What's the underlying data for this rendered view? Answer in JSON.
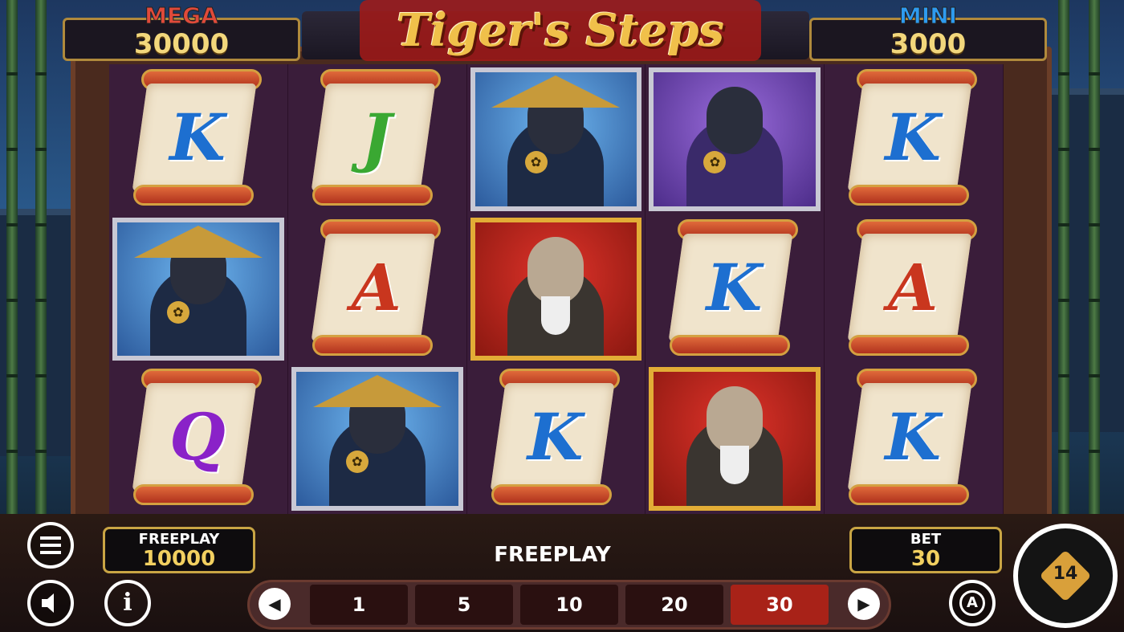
{
  "game_title": "Tiger's Steps",
  "jackpots": {
    "mega": {
      "label": "MEGA",
      "value": "30000",
      "color": "#e04a3a"
    },
    "mini": {
      "label": "MINI",
      "value": "3000",
      "color": "#2e9bef"
    }
  },
  "reels": [
    [
      {
        "type": "scroll",
        "letter": "K",
        "color": "#1d6fd0"
      },
      {
        "type": "ninja-blue"
      },
      {
        "type": "scroll",
        "letter": "Q",
        "color": "#8a22c8"
      }
    ],
    [
      {
        "type": "scroll",
        "letter": "J",
        "color": "#3aa832"
      },
      {
        "type": "scroll",
        "letter": "A",
        "color": "#c9361e"
      },
      {
        "type": "ninja-blue"
      }
    ],
    [
      {
        "type": "ninja-blue"
      },
      {
        "type": "monk"
      },
      {
        "type": "scroll",
        "letter": "K",
        "color": "#1d6fd0"
      }
    ],
    [
      {
        "type": "ninja-purple"
      },
      {
        "type": "scroll",
        "letter": "K",
        "color": "#1d6fd0"
      },
      {
        "type": "monk"
      }
    ],
    [
      {
        "type": "scroll",
        "letter": "K",
        "color": "#1d6fd0"
      },
      {
        "type": "scroll",
        "letter": "A",
        "color": "#c9361e"
      },
      {
        "type": "scroll",
        "letter": "K",
        "color": "#1d6fd0"
      }
    ]
  ],
  "balance": {
    "label": "FREEPLAY",
    "value": "10000"
  },
  "mode_label": "FREEPLAY",
  "bet": {
    "label": "BET",
    "value": "30"
  },
  "bet_options": [
    "1",
    "5",
    "10",
    "20",
    "30"
  ],
  "selected_bet": "30",
  "icons": {
    "menu": "menu-icon",
    "sound": "speaker-icon",
    "info": "info-icon",
    "prev": "chevron-left-icon",
    "next": "chevron-right-icon",
    "autoplay": "autoplay-icon",
    "spin": "spin-icon"
  },
  "autoplay_label": "A",
  "info_label": "i",
  "spin_label": "14"
}
